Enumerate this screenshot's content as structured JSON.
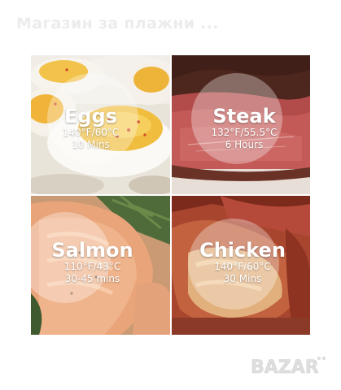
{
  "watermark": {
    "title": "Магазин за плажни ..."
  },
  "tiles": {
    "eggs": {
      "name": "Eggs",
      "temp": "140°F/60°C",
      "time": "10 Mins"
    },
    "steak": {
      "name": "Steak",
      "temp": "132°F/55.5°C",
      "time": "6 Hours"
    },
    "salmon": {
      "name": "Salmon",
      "temp": "110°F/43°C",
      "time": "30-45 mins"
    },
    "chicken": {
      "name": "Chicken",
      "temp": "140°F/60°C",
      "time": "30 Mins"
    }
  },
  "logo": {
    "text": "BAZAR",
    "color": "#dcdcdc"
  }
}
